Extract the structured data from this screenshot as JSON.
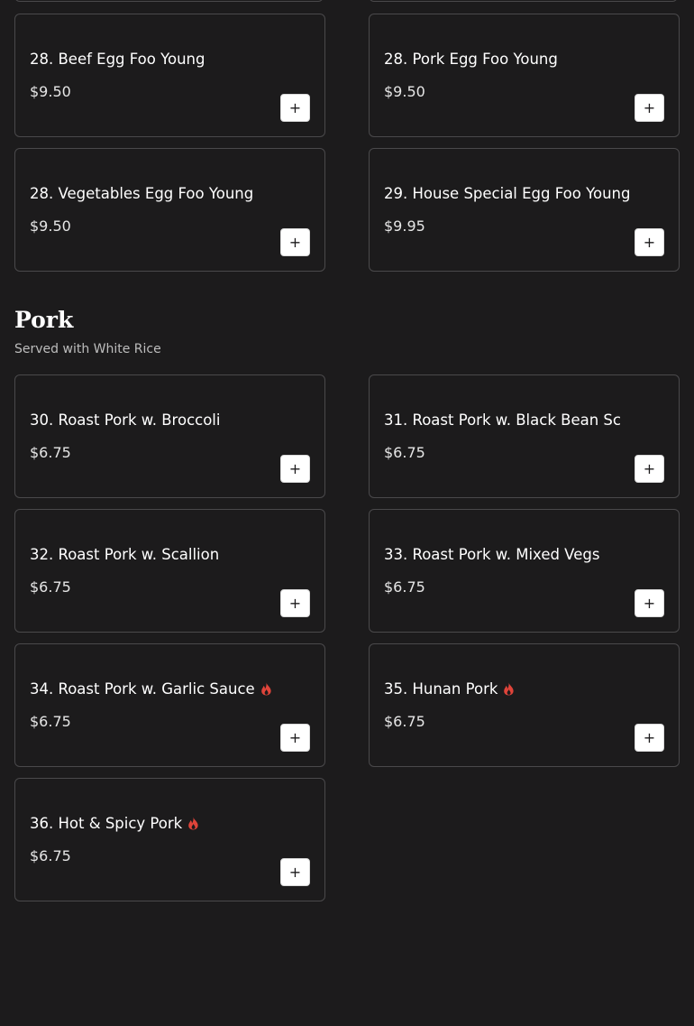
{
  "section_prev": {
    "items": [
      {
        "name": "28. Beef Egg Foo Young",
        "price": "$9.50",
        "spicy": false
      },
      {
        "name": "28. Pork Egg Foo Young",
        "price": "$9.50",
        "spicy": false
      },
      {
        "name": "28. Vegetables Egg Foo Young",
        "price": "$9.50",
        "spicy": false
      },
      {
        "name": "29. House Special Egg Foo Young",
        "price": "$9.95",
        "spicy": false
      }
    ]
  },
  "section_pork": {
    "title": "Pork",
    "subtitle": "Served with White Rice",
    "items": [
      {
        "name": "30. Roast Pork w. Broccoli",
        "price": "$6.75",
        "spicy": false
      },
      {
        "name": "31. Roast Pork w. Black Bean Sc",
        "price": "$6.75",
        "spicy": false
      },
      {
        "name": "32. Roast Pork w. Scallion",
        "price": "$6.75",
        "spicy": false
      },
      {
        "name": "33. Roast Pork w. Mixed Vegs",
        "price": "$6.75",
        "spicy": false
      },
      {
        "name": "34. Roast Pork w. Garlic Sauce",
        "price": "$6.75",
        "spicy": true
      },
      {
        "name": "35. Hunan Pork",
        "price": "$6.75",
        "spicy": true
      },
      {
        "name": "36. Hot & Spicy Pork",
        "price": "$6.75",
        "spicy": true
      }
    ]
  },
  "icons": {
    "add": "plus-icon",
    "spicy": "flame-icon"
  },
  "colors": {
    "background": "#1c1b1c",
    "card_border": "#4a494b",
    "text": "#ffffff",
    "spicy": "#e0443a",
    "add_button_bg": "#ffffff"
  },
  "add_button_glyph": "+"
}
